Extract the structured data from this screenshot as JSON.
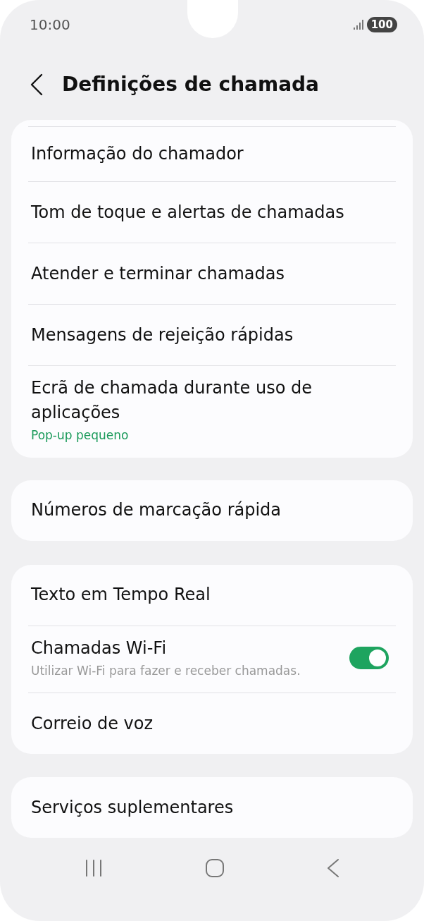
{
  "status_bar": {
    "time": "10:00",
    "battery": "100"
  },
  "header": {
    "title": "Definições de chamada"
  },
  "groups": [
    {
      "cut_top": true,
      "items": [
        {
          "kind": "link",
          "title": "Informação do chamador"
        },
        {
          "kind": "link",
          "title": "Tom de toque e alertas de chamadas"
        },
        {
          "kind": "link",
          "title": "Atender e terminar chamadas"
        },
        {
          "kind": "link",
          "title": "Mensagens de rejeição rápidas"
        },
        {
          "kind": "value",
          "title": "Ecrã de chamada durante uso de aplicações",
          "subtitle": "Pop-up pequeno"
        }
      ]
    },
    {
      "cut_top": false,
      "items": [
        {
          "kind": "link",
          "title": "Números de marcação rápida"
        }
      ]
    },
    {
      "cut_top": false,
      "items": [
        {
          "kind": "link",
          "title": "Texto em Tempo Real"
        },
        {
          "kind": "toggle",
          "title": "Chamadas Wi-Fi",
          "subtitle": "Utilizar Wi-Fi para fazer e receber chamadas.",
          "on": true
        },
        {
          "kind": "link",
          "title": "Correio de voz"
        }
      ]
    },
    {
      "cut_top": false,
      "items": [
        {
          "kind": "link",
          "title": "Serviços suplementares"
        }
      ]
    }
  ]
}
